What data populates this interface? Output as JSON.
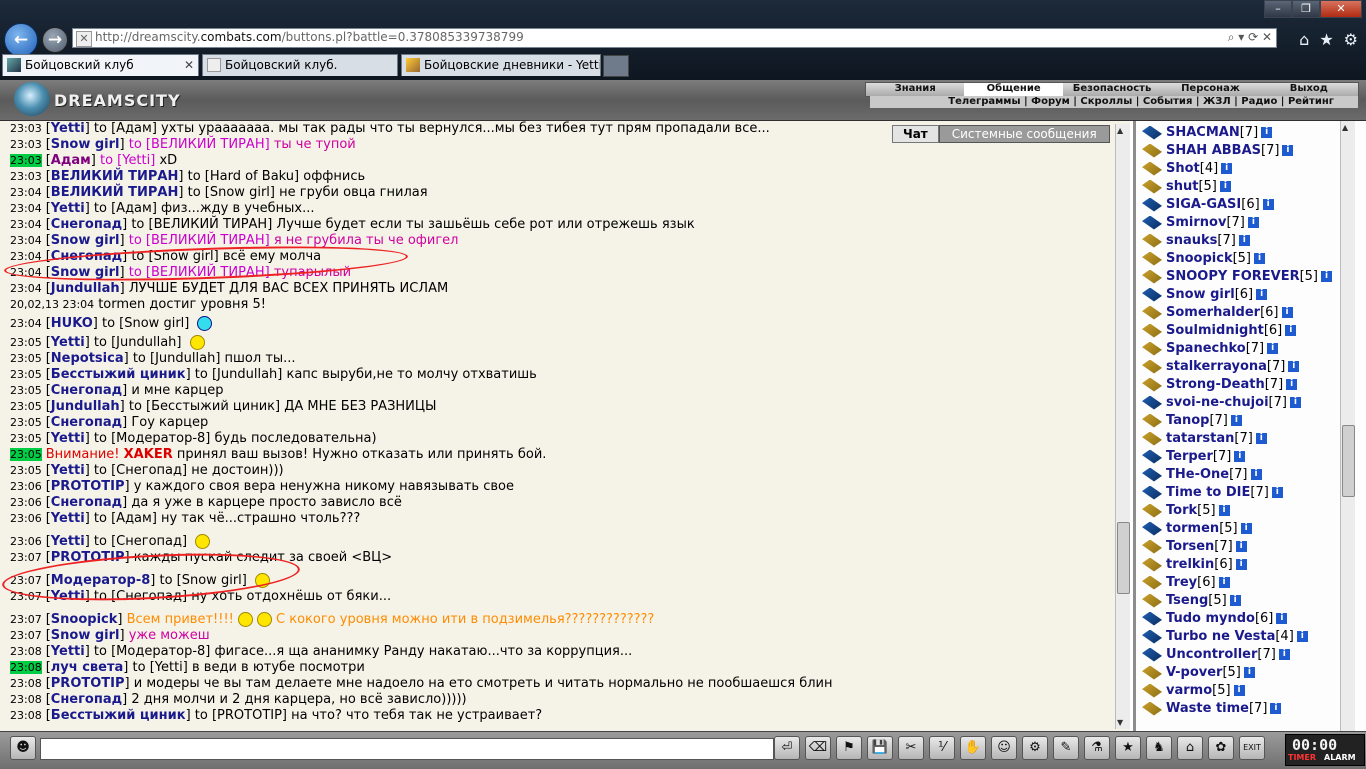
{
  "browser": {
    "url_prefix": "http://dreamscity.",
    "url_domain": "combats.com",
    "url_path": "/buttons.pl?battle=0.378085339738799",
    "addr_tools": "⌕ ▾ ⟳ ✕",
    "tabs": [
      {
        "title": "Бойцовский клуб"
      },
      {
        "title": "Бойцовский клуб."
      },
      {
        "title": "Бойцовские дневники - Yetti"
      }
    ],
    "toolbar_icons": [
      "home-icon",
      "star-icon",
      "gear-icon"
    ],
    "win_controls": {
      "min": "–",
      "max": "❐",
      "close": "✕"
    }
  },
  "game": {
    "logo": "DREAMSCITY",
    "menu": [
      "Знания",
      "Общение",
      "Безопасность",
      "Персонаж",
      "Выход"
    ],
    "menu_active": "Общение",
    "submenu": [
      "Телеграммы",
      "Форум",
      "Скроллы",
      "События",
      "ЖЗЛ",
      "Радио",
      "Рейтинг"
    ],
    "submenu_sep": "|"
  },
  "chat": {
    "tab_chat": "Чат",
    "tab_system": "Системные сообщения",
    "lines": [
      {
        "t": "23:03",
        "n": "Yetti",
        "to": "to [Адам]",
        "m": "ухты урааааааа. мы так рады что ты вернулся...мы без тибея тут прям пропадали все..."
      },
      {
        "t": "23:03",
        "n": "Snow girl",
        "to": "to [ВЕЛИКИЙ ТИРАН]",
        "m": "ты че тупой",
        "pm": true
      },
      {
        "t": "23:03",
        "n": "Адам",
        "to": "to [Yetti]",
        "m": "xD",
        "purple": true,
        "green": true
      },
      {
        "t": "23:03",
        "n": "ВЕЛИКИЙ ТИРАН",
        "to": "to [Hard of Baku]",
        "m": "оффнись"
      },
      {
        "t": "23:04",
        "n": "ВЕЛИКИЙ ТИРАН",
        "to": "to [Snow girl]",
        "m": "не груби овца гнилая"
      },
      {
        "t": "23:04",
        "n": "Yetti",
        "to": "to [Адам]",
        "m": "физ...жду в учебных..."
      },
      {
        "t": "23:04",
        "n": "Снегопад",
        "to": "to [ВЕЛИКИЙ ТИРАН]",
        "m": "Лучше будет если ты зашьёшь себе рот или отрежешь язык"
      },
      {
        "t": "23:04",
        "n": "Snow girl",
        "to": "to [ВЕЛИКИЙ ТИРАН]",
        "m": "я не грубила ты че офигел",
        "pm": true
      },
      {
        "t": "23:04",
        "n": "Снегопад",
        "to": "to [Snow girl]",
        "m": "всё ему молча"
      },
      {
        "t": "23:04",
        "n": "Snow girl",
        "to": "to [ВЕЛИКИЙ ТИРАН]",
        "m": "тупарылый",
        "pm": true
      },
      {
        "t": "23:04",
        "n": "Jundullah",
        "to": "",
        "m": "ЛУЧШЕ БУДЕТ ДЛЯ ВАС ВСЕХ ПРИНЯТЬ ИСЛАМ"
      },
      {
        "t": "20,02,13 23:04",
        "n": "",
        "to": "",
        "m": "tormen достиг уровня 5!",
        "system": true
      },
      {
        "t": "23:04",
        "n": "НUKO",
        "to": "to [Snow girl]",
        "m": "",
        "smile": "b",
        "tall": true
      },
      {
        "t": "23:05",
        "n": "Yetti",
        "to": "to [Jundullah]",
        "m": "",
        "smile": "y",
        "tall": true
      },
      {
        "t": "23:05",
        "n": "Nepotsica",
        "to": "to [Jundullah]",
        "m": "пшол ты..."
      },
      {
        "t": "23:05",
        "n": "Бесстыжий циник",
        "to": "to [Jundullah]",
        "m": "капс выруби,не то молчу отхватишь"
      },
      {
        "t": "23:05",
        "n": "Снегопад",
        "to": "",
        "m": "и мне карцер"
      },
      {
        "t": "23:05",
        "n": "Jundullah",
        "to": "to [Бесстыжий циник]",
        "m": "ДА МНЕ БЕЗ РАЗНИЦЫ"
      },
      {
        "t": "23:05",
        "n": "Снегопад",
        "to": "",
        "m": "Гоу карцер"
      },
      {
        "t": "23:05",
        "n": "Yetti",
        "to": "to [Модератор-8]",
        "m": "будь последовательна)"
      },
      {
        "t": "23:05",
        "n": "",
        "to": "",
        "m": "принял ваш вызов! Нужно отказать или принять бой.",
        "warn": "Внимание!",
        "warn_nick": "XAKER",
        "green": true
      },
      {
        "t": "23:05",
        "n": "Yetti",
        "to": "to [Снегопад]",
        "m": "не достоин)))"
      },
      {
        "t": "23:06",
        "n": "PROTOTIP",
        "to": "",
        "m": "у каждого своя вера ненужна никому навязывать свое"
      },
      {
        "t": "23:06",
        "n": "Снегопад",
        "to": "",
        "m": "да я уже в карцере просто зависло всё"
      },
      {
        "t": "23:06",
        "n": "Yetti",
        "to": "to [Адам]",
        "m": "ну так чё...страшно чтоль???"
      },
      {
        "t": "23:06",
        "n": "Yetti",
        "to": "to [Снегопад]",
        "m": "",
        "smile": "y",
        "taller": true
      },
      {
        "t": "23:07",
        "n": "PROTOTIP",
        "to": "",
        "m": "кажды пускай следит за своей <ВЦ>"
      },
      {
        "t": "23:07",
        "n": "Модератор-8",
        "to": "to [Snow girl]",
        "m": "",
        "smile": "y",
        "taller": true
      },
      {
        "t": "23:07",
        "n": "Yetti",
        "to": "to [Снегопад]",
        "m": "ну хоть отдохнёшь от бяки..."
      },
      {
        "t": "23:07",
        "n": "Snoopick",
        "to": "",
        "m": "Всем привет!!!!",
        "extra": "С кокого уровня можно ити в подзимелья?????????????",
        "orange": true,
        "taller": true
      },
      {
        "t": "23:07",
        "n": "Snow girl",
        "to": "",
        "m": "уже можеш",
        "pm": true
      },
      {
        "t": "23:08",
        "n": "Yetti",
        "to": "to [Модератор-8]",
        "m": "фигасе...я ща ананимку Ранду накатаю...что за коррупция..."
      },
      {
        "t": "23:08",
        "n": "луч света",
        "to": "to [Yetti]",
        "m": "в веди в ютубе посмотри",
        "green": true
      },
      {
        "t": "23:08",
        "n": "PROTOTIP",
        "to": "",
        "m": "и модеры че вы там делаете мне надоело на ето смотреть и читать нормально не пообшаешся блин"
      },
      {
        "t": "23:08",
        "n": "Снегопад",
        "to": "",
        "m": "2 дня молчи и 2 дня карцера, но всё зависло)))))"
      },
      {
        "t": "23:08",
        "n": "Бесстыжий циник",
        "to": "to [PROTOTIP]",
        "m": "на что? что тебя так не устраивает?"
      }
    ]
  },
  "users": [
    {
      "n": "SHACMAN",
      "l": "[7]",
      "c": "blue"
    },
    {
      "n": "SHAH ABBAS",
      "l": "[7]",
      "c": "gold"
    },
    {
      "n": "Shot",
      "l": "[4]",
      "c": "gold"
    },
    {
      "n": "shut",
      "l": "[5]",
      "c": "gold"
    },
    {
      "n": "SIGA-GASI",
      "l": "[6]",
      "c": "blue"
    },
    {
      "n": "Smirnov",
      "l": "[7]",
      "c": "blue"
    },
    {
      "n": "snauks",
      "l": "[7]",
      "c": "gold"
    },
    {
      "n": "Snoopick",
      "l": "[5]",
      "c": "gold"
    },
    {
      "n": "SNOOPY FOREVER",
      "l": "[5]",
      "c": "gold"
    },
    {
      "n": "Snow girl",
      "l": "[6]",
      "c": "blue"
    },
    {
      "n": "Somerhalder",
      "l": "[6]",
      "c": "gold"
    },
    {
      "n": "Soulmidnight",
      "l": "[6]",
      "c": "gold"
    },
    {
      "n": "Spanechko",
      "l": "[7]",
      "c": "gold"
    },
    {
      "n": "stalkerrayona",
      "l": "[7]",
      "c": "gold"
    },
    {
      "n": "Strong-Death",
      "l": "[7]",
      "c": "gold"
    },
    {
      "n": "svoi-ne-chujoi",
      "l": "[7]",
      "c": "blue"
    },
    {
      "n": "Tanop",
      "l": "[7]",
      "c": "gold"
    },
    {
      "n": "tatarstan",
      "l": "[7]",
      "c": "gold"
    },
    {
      "n": "Terper",
      "l": "[7]",
      "c": "blue"
    },
    {
      "n": "THe-One",
      "l": "[7]",
      "c": "blue"
    },
    {
      "n": "Time to DIE",
      "l": "[7]",
      "c": "blue"
    },
    {
      "n": "Tork",
      "l": "[5]",
      "c": "gold"
    },
    {
      "n": "tormen",
      "l": "[5]",
      "c": "blue"
    },
    {
      "n": "Torsen",
      "l": "[7]",
      "c": "gold"
    },
    {
      "n": "trelkin",
      "l": "[6]",
      "c": "gold"
    },
    {
      "n": "Trey",
      "l": "[6]",
      "c": "gold"
    },
    {
      "n": "Tseng",
      "l": "[5]",
      "c": "gold"
    },
    {
      "n": "Tudo myndo",
      "l": "[6]",
      "c": "blue"
    },
    {
      "n": "Turbo ne Vesta",
      "l": "[4]",
      "c": "blue"
    },
    {
      "n": "Uncontroller",
      "l": "[7]",
      "c": "blue"
    },
    {
      "n": "V-pover",
      "l": "[5]",
      "c": "gold"
    },
    {
      "n": "varmo",
      "l": "[5]",
      "c": "gold"
    },
    {
      "n": "Waste time",
      "l": "[7]",
      "c": "gold"
    }
  ],
  "toolbar": {
    "timer": "00:00",
    "timer_label": "TIMER",
    "alarm_label": "ALARM",
    "tools": [
      "⏎",
      "⌫",
      "⚑",
      "💾",
      "✂",
      "⅟",
      "✋",
      "☺",
      "⚙",
      "✎",
      "⚗",
      "★",
      "♞",
      "⌂",
      "✿",
      "EXIT"
    ]
  }
}
